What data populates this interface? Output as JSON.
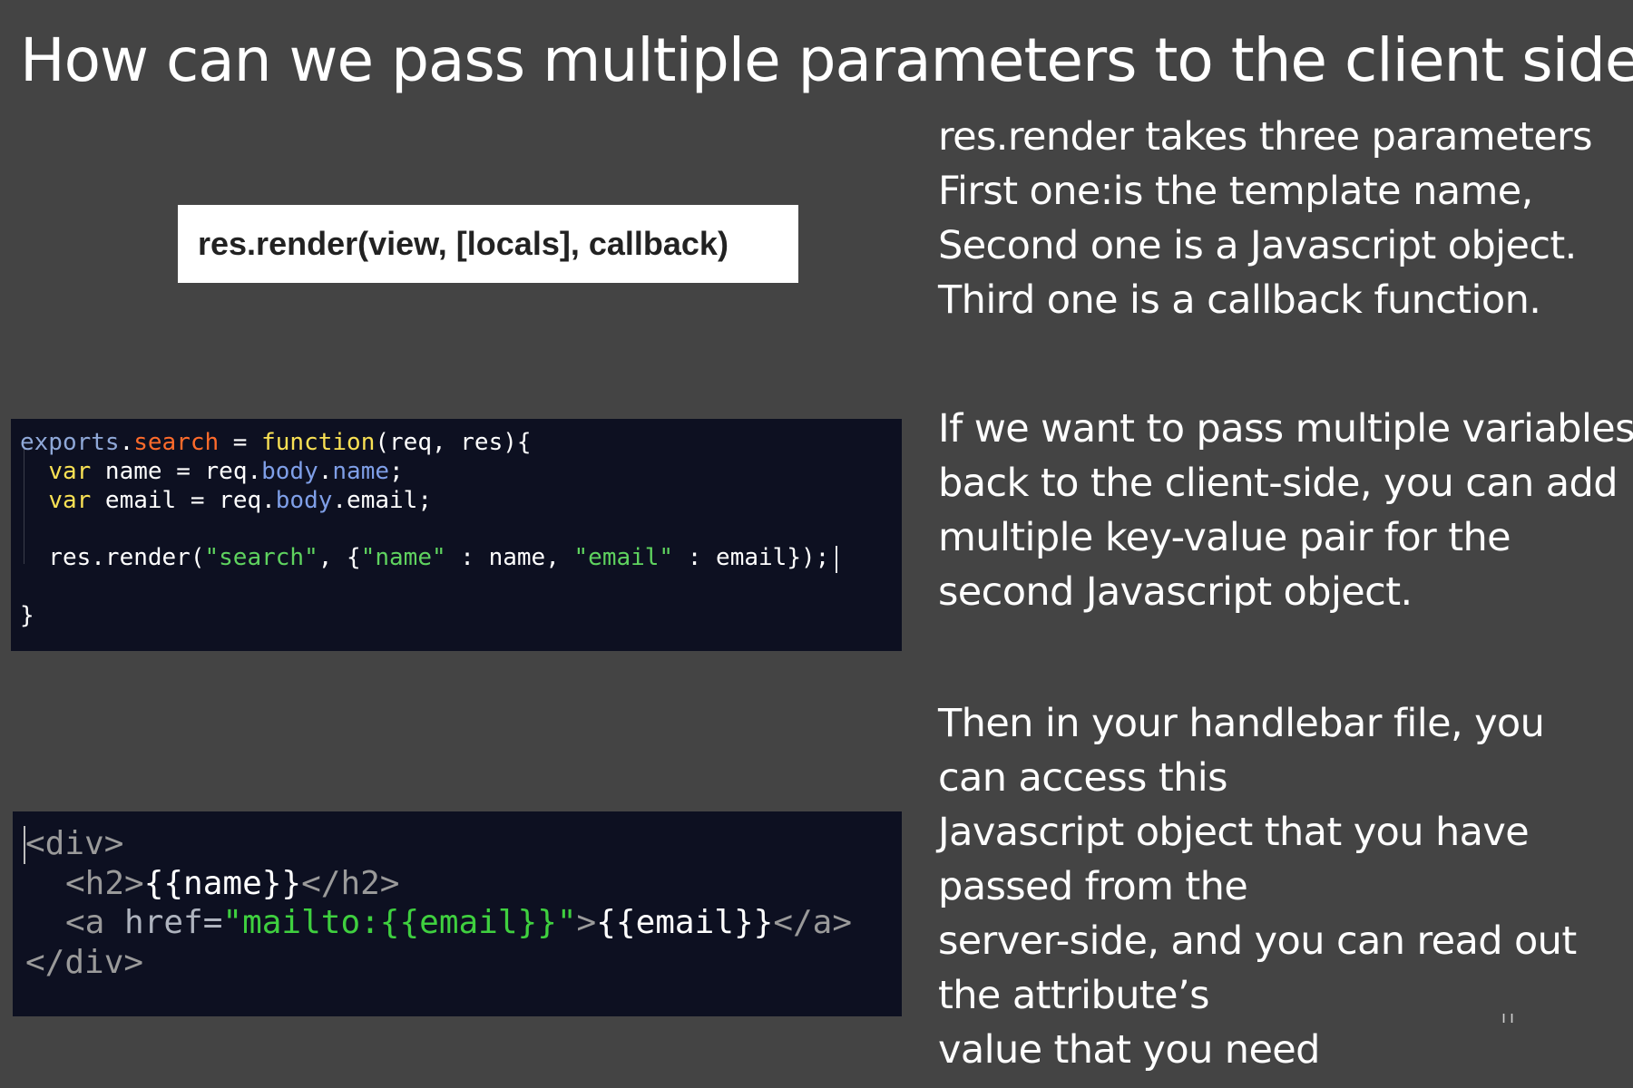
{
  "slide": {
    "title": "How can we pass multiple parameters to the client side?"
  },
  "signature": {
    "text": "res.render(view, [locals], callback)"
  },
  "code_js": {
    "l1": {
      "exports": "exports",
      "dot": ".",
      "search": "search",
      "eq": " = ",
      "function": "function",
      "params": "(req, res){"
    },
    "l2": {
      "indent": "  ",
      "var": "var",
      "rest_a": " name = req.",
      "body": "body",
      "dot": ".",
      "name": "name",
      "semi": ";"
    },
    "l3": {
      "indent": "  ",
      "var": "var",
      "rest": " email = req.",
      "body": "body",
      "tail": ".email;"
    },
    "l4": {
      "a": "  res.render(",
      "s1": "\"search\"",
      "b": ", {",
      "s2": "\"name\"",
      "c": " : name, ",
      "s3": "\"email\"",
      "d": " : email});"
    },
    "l5": {
      "brace": "}"
    }
  },
  "code_hbs": {
    "l1": {
      "tag": "<div>"
    },
    "l2": {
      "open": "<h2>",
      "expr": "{{name}}",
      "close": "</h2>"
    },
    "l3": {
      "open": "<a ",
      "attr": "href=",
      "str": "\"mailto:{{email}}\"",
      "gt": ">",
      "expr": "{{email}}",
      "close": "</a>"
    },
    "l4": {
      "tag": "</div>"
    }
  },
  "explanations": {
    "render_params": [
      "res.render takes three parameters",
      "First one:is the template name,",
      "Second one is a Javascript object.",
      "Third one is a callback function."
    ],
    "multiple_vars": [
      "If we want to pass multiple variables",
      "back to the client-side, you can add",
      "multiple key-value pair for the",
      "second Javascript object."
    ],
    "handlebar": [
      "Then in your handlebar file, you",
      "can access this",
      "Javascript object that you have",
      "passed from the",
      "server-side, and you can read out",
      "the attribute’s",
      "value that you need"
    ]
  },
  "corner_mark": "ıı",
  "colors": {
    "background": "#444444",
    "code_background": "#0d1021",
    "js_property": "#ff6b2b",
    "js_keyword": "#f9e154",
    "js_string": "#5fd35f",
    "html_tag": "#9a9a9a"
  }
}
